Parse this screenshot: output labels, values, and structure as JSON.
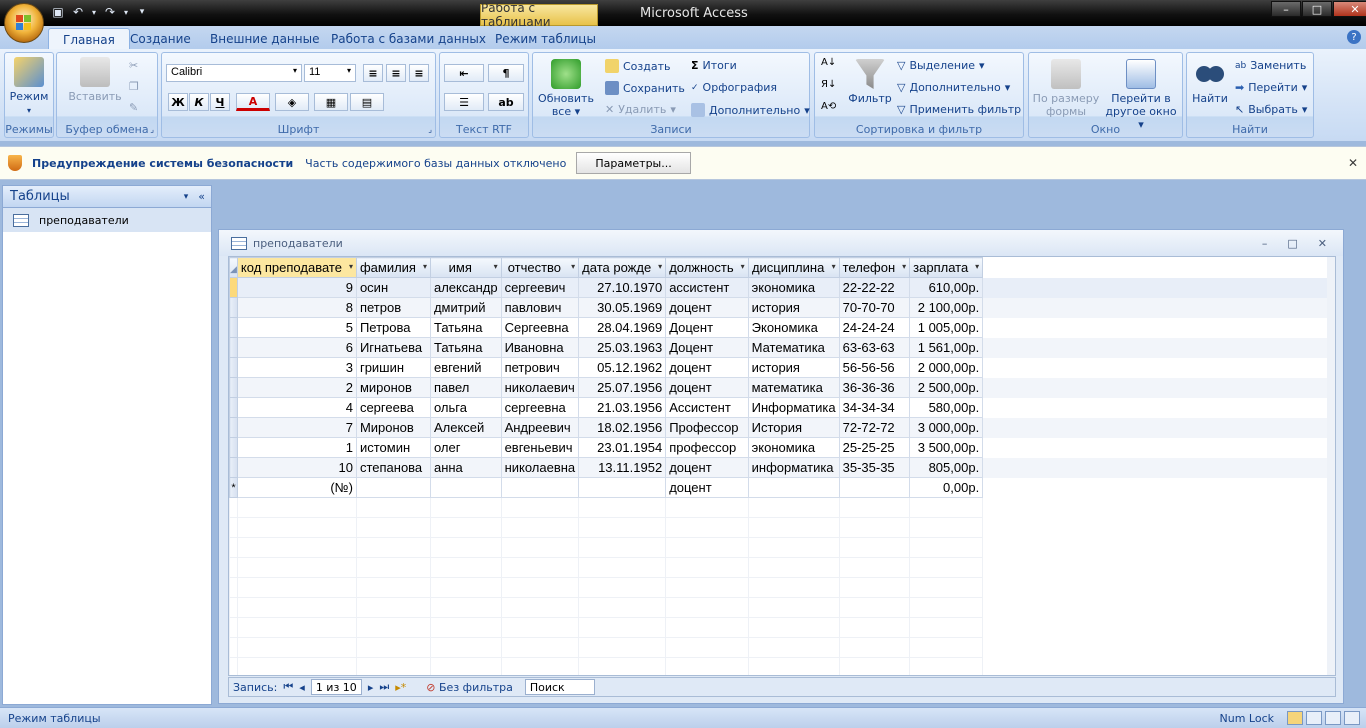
{
  "window": {
    "title": "Microsoft Access",
    "context_tab": "Работа с таблицами",
    "controls": {
      "minimize": "–",
      "maximize": "□",
      "close": "✕"
    }
  },
  "ribbon": {
    "tabs": [
      "Главная",
      "Создание",
      "Внешние данные",
      "Работа с базами данных",
      "Режим таблицы"
    ],
    "active_tab": "Главная",
    "groups": {
      "modes": {
        "label": "Режимы",
        "view_btn": "Режим"
      },
      "clipboard": {
        "label": "Буфер обмена",
        "paste_btn": "Вставить"
      },
      "font": {
        "label": "Шрифт",
        "font_name": "Calibri",
        "font_size": "11",
        "bold": "Ж",
        "italic": "К",
        "underline": "Ч",
        "color": "A"
      },
      "rtf": {
        "label": "Текст RTF"
      },
      "records": {
        "label": "Записи",
        "refresh_btn": "Обновить",
        "refresh_btn2": "все",
        "create": "Создать",
        "save": "Сохранить",
        "delete": "Удалить",
        "totals": "Итоги",
        "spelling": "Орфография",
        "more": "Дополнительно"
      },
      "sort_filter": {
        "label": "Сортировка и фильтр",
        "filter_btn": "Фильтр",
        "selection": "Выделение",
        "advanced": "Дополнительно",
        "apply_filter": "Применить фильтр"
      },
      "window": {
        "label": "Окно",
        "fit_form": "По размеру",
        "fit_form2": "формы",
        "switch_window": "Перейти в",
        "switch_window2": "другое окно"
      },
      "find": {
        "label": "Найти",
        "find_btn": "Найти",
        "replace": "Заменить",
        "goto": "Перейти",
        "select": "Выбрать"
      }
    }
  },
  "security_bar": {
    "title": "Предупреждение системы безопасности",
    "message": "Часть содержимого базы данных отключено",
    "button": "Параметры..."
  },
  "nav_pane": {
    "header": "Таблицы",
    "items": [
      "преподаватели"
    ]
  },
  "document": {
    "title": "преподаватели",
    "columns": [
      "код преподавате",
      "фамилия",
      "имя",
      "отчество",
      "дата рожде",
      "должность",
      "дисциплина",
      "телефон",
      "зарплата"
    ],
    "rows": [
      [
        "9",
        "осин",
        "александр",
        "сергеевич",
        "27.10.1970",
        "ассистент",
        "экономика",
        "22-22-22",
        "610,00р."
      ],
      [
        "8",
        "петров",
        "дмитрий",
        "павлович",
        "30.05.1969",
        "доцент",
        "история",
        "70-70-70",
        "2 100,00р."
      ],
      [
        "5",
        "Петрова",
        "Татьяна",
        "Сергеевна",
        "28.04.1969",
        "Доцент",
        "Экономика",
        "24-24-24",
        "1 005,00р."
      ],
      [
        "6",
        "Игнатьева",
        "Татьяна",
        "Ивановна",
        "25.03.1963",
        "Доцент",
        "Математика",
        "63-63-63",
        "1 561,00р."
      ],
      [
        "3",
        "гришин",
        "евгений",
        "петрович",
        "05.12.1962",
        "доцент",
        "история",
        "56-56-56",
        "2 000,00р."
      ],
      [
        "2",
        "миронов",
        "павел",
        "николаевич",
        "25.07.1956",
        "доцент",
        "математика",
        "36-36-36",
        "2 500,00р."
      ],
      [
        "4",
        "сергеева",
        "ольга",
        "сергеевна",
        "21.03.1956",
        "Ассистент",
        "Информатика",
        "34-34-34",
        "580,00р."
      ],
      [
        "7",
        "Миронов",
        "Алексей",
        "Андреевич",
        "18.02.1956",
        "Профессор",
        "История",
        "72-72-72",
        "3 000,00р."
      ],
      [
        "1",
        "истомин",
        "олег",
        "евгеньевич",
        "23.01.1954",
        "профессор",
        "экономика",
        "25-25-25",
        "3 500,00р."
      ],
      [
        "10",
        "степанова",
        "анна",
        "николаевна",
        "13.11.1952",
        "доцент",
        "информатика",
        "35-35-35",
        "805,00р."
      ]
    ],
    "new_row": [
      "(№)",
      "",
      "",
      "",
      "",
      "доцент",
      "",
      "",
      "0,00р."
    ],
    "new_row_marker": "*",
    "record_nav": {
      "label": "Запись:",
      "position": "1 из 10",
      "filter": "Без фильтра",
      "search": "Поиск"
    }
  },
  "status_bar": {
    "left": "Режим таблицы",
    "numlock": "Num Lock"
  }
}
